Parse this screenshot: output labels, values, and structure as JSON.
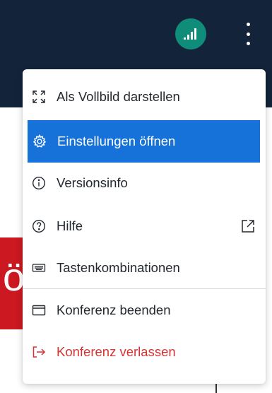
{
  "topbar": {
    "status_icon": "signal-bars-icon",
    "more_icon": "kebab-menu-icon",
    "status_color": "#0f8c7a",
    "background_color": "#13243a"
  },
  "background": {
    "red_strip_text": "ö",
    "red_strip_color": "#cc1820"
  },
  "menu": {
    "items": [
      {
        "label": "Als Vollbild darstellen",
        "icon": "fullscreen-icon"
      },
      {
        "label": "Einstellungen öffnen",
        "icon": "gear-icon",
        "active": true
      },
      {
        "label": "Versionsinfo",
        "icon": "info-icon"
      },
      {
        "label": "Hilfe",
        "icon": "help-icon",
        "trailing_icon": "external-link-icon"
      },
      {
        "label": "Tastenkombinationen",
        "icon": "keyboard-icon"
      },
      {
        "label": "Konferenz beenden",
        "icon": "window-icon"
      },
      {
        "label": "Konferenz verlassen",
        "icon": "exit-arrow-icon",
        "danger": true
      }
    ],
    "active_color": "#1672d8",
    "danger_color": "#d53434"
  }
}
